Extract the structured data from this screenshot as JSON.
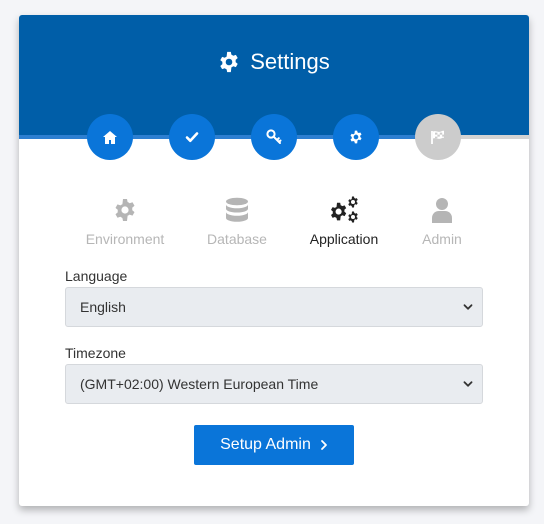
{
  "header": {
    "title": "Settings",
    "icon": "gear-icon",
    "background": "#005ea8"
  },
  "progress": {
    "steps": [
      {
        "icon": "home-icon",
        "state": "completed"
      },
      {
        "icon": "checkmark-icon",
        "state": "completed"
      },
      {
        "icon": "key-icon",
        "state": "completed"
      },
      {
        "icon": "gear-icon",
        "state": "current"
      },
      {
        "icon": "flag-icon",
        "state": "pending"
      }
    ],
    "accent": "#0a75d9",
    "pending_color": "#cccccc"
  },
  "tabs": [
    {
      "label": "Environment",
      "icon": "gear-icon",
      "active": false
    },
    {
      "label": "Database",
      "icon": "database-icon",
      "active": false
    },
    {
      "label": "Application",
      "icon": "gears-icon",
      "active": true
    },
    {
      "label": "Admin",
      "icon": "user-icon",
      "active": false
    }
  ],
  "form": {
    "language": {
      "label": "Language",
      "value": "English"
    },
    "timezone": {
      "label": "Timezone",
      "value": "(GMT+02:00) Western European Time"
    }
  },
  "actions": {
    "submit_label": "Setup Admin",
    "submit_icon": "chevron-right-icon",
    "color": "#0a75d9"
  }
}
